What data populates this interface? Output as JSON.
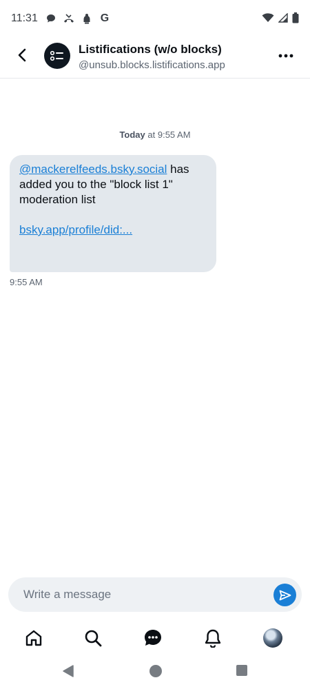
{
  "status_bar": {
    "time": "11:31",
    "left_icons": [
      "chat-bubble-icon",
      "missed-call-icon",
      "notification-icon",
      "google-icon"
    ],
    "right_icons": [
      "wifi-icon",
      "cellular-signal-icon",
      "battery-icon"
    ],
    "google_letter": "G"
  },
  "header": {
    "title": "Listifications (w/o blocks)",
    "handle": "@unsub.blocks.listifications.app"
  },
  "conversation": {
    "date_separator_day": "Today",
    "date_separator_time": " at 9:55 AM",
    "message": {
      "mention": "@mackerelfeeds.bsky.social",
      "text": " has added you to the \"block list 1\" moderation list",
      "link": "bsky.app/profile/did:...",
      "time": "9:55 AM"
    }
  },
  "composer": {
    "placeholder": "Write a message"
  },
  "bottom_nav": {
    "items": [
      "home-icon",
      "search-icon",
      "messages-icon",
      "notifications-icon",
      "profile-avatar"
    ]
  },
  "colors": {
    "accent": "#1a7fd6",
    "bubble": "#e3e8ed",
    "composer_bg": "#eef1f4"
  }
}
